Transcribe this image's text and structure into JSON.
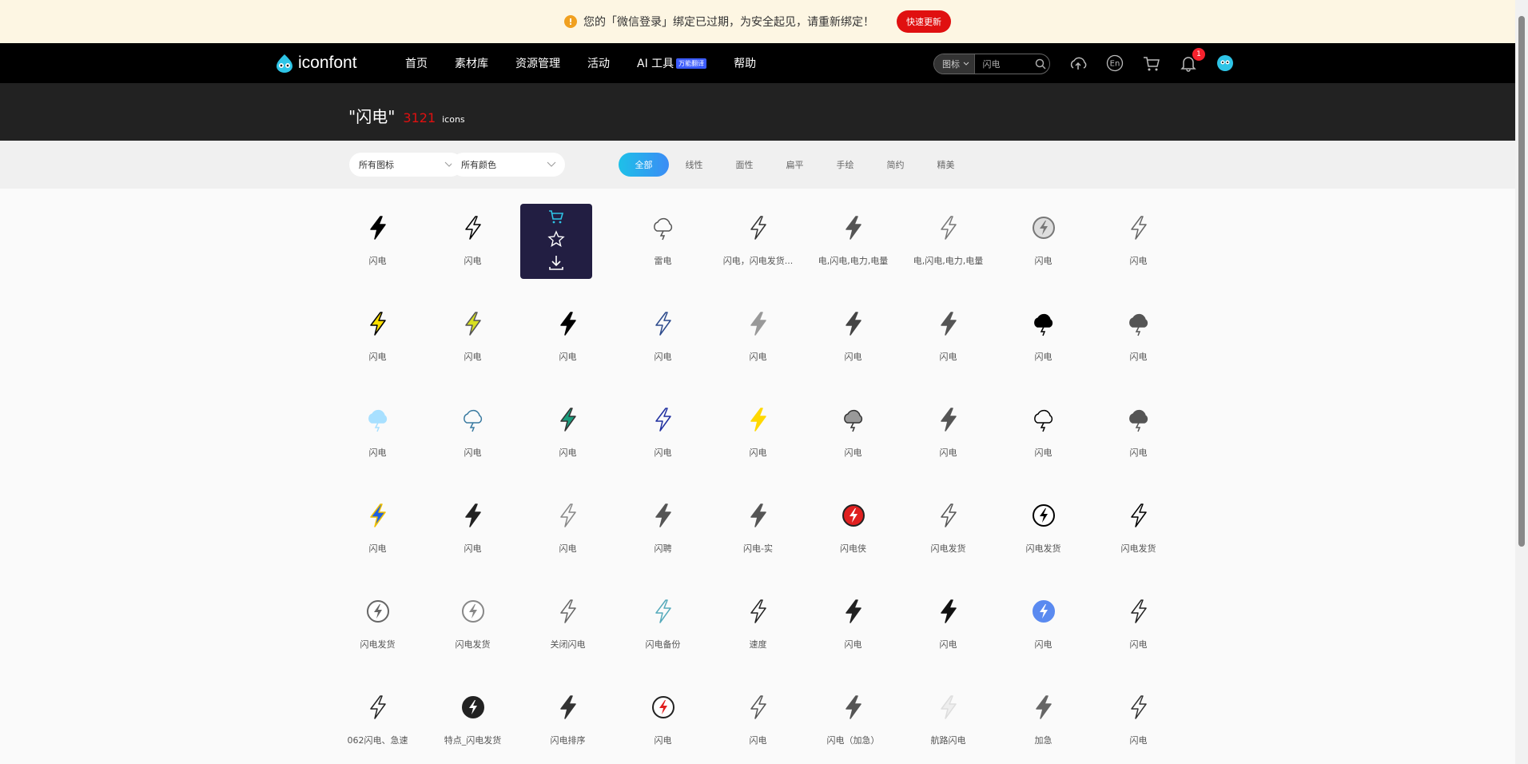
{
  "notice": {
    "message": "您的「微信登录」绑定已过期，为安全起见，请重新绑定！",
    "button": "快速更新"
  },
  "nav": {
    "logo": "iconfont",
    "links": [
      "首页",
      "素材库",
      "资源管理",
      "活动",
      "AI 工具",
      "帮助"
    ],
    "ai_tag": "万能翻译",
    "search_type": "图标",
    "search_value": "闪电",
    "lang": "En",
    "notifications": "1"
  },
  "hero": {
    "query": "\"闪电\"",
    "count": "3121",
    "unit": "icons"
  },
  "filters": {
    "icon_select": "所有图标",
    "color_select": "所有颜色",
    "tabs": [
      "全部",
      "线性",
      "面性",
      "扁平",
      "手绘",
      "简约",
      "精美"
    ]
  },
  "icons": [
    [
      "闪电",
      "闪电",
      "",
      "雷电",
      "闪电，闪电发货...",
      "电,闪电,电力,电量",
      "电,闪电,电力,电量",
      "闪电",
      "闪电"
    ],
    [
      "闪电",
      "闪电",
      "闪电",
      "闪电",
      "闪电",
      "闪电",
      "闪电",
      "闪电",
      "闪电"
    ],
    [
      "闪电",
      "闪电",
      "闪电",
      "闪电",
      "闪电",
      "闪电",
      "闪电",
      "闪电",
      "闪电"
    ],
    [
      "闪电",
      "闪电",
      "闪电",
      "闪聘",
      "闪电-实",
      "闪电侠",
      "闪电发货",
      "闪电发货",
      "闪电发货"
    ],
    [
      "闪电发货",
      "闪电发货",
      "关闭闪电",
      "闪电备份",
      "速度",
      "闪电",
      "闪电",
      "闪电",
      "闪电"
    ],
    [
      "062闪电、急速",
      "特点_闪电发货",
      "闪电排序",
      "闪电",
      "闪电",
      "闪电（加急）",
      "航路闪电",
      "加急",
      "闪电"
    ]
  ],
  "colors": {
    "accent_red": "#e01010",
    "tab_gradient_start": "#1ec0e8",
    "tab_gradient_end": "#3b8cf5",
    "hover_card": "#221e42"
  }
}
